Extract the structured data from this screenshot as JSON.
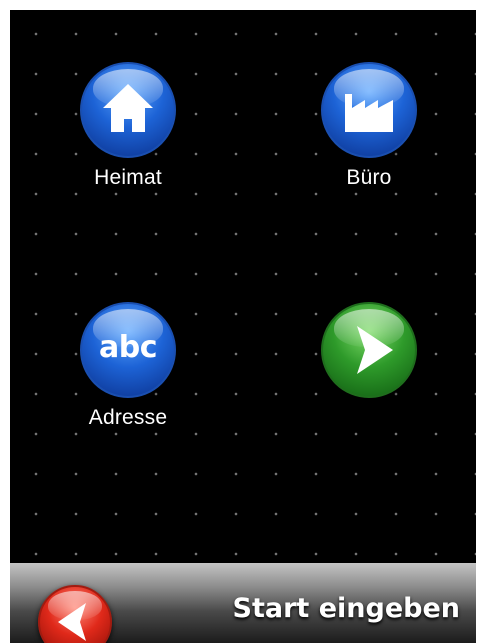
{
  "tiles": [
    {
      "label": "Heimat",
      "icon": "home-icon",
      "color": "#1d63d6"
    },
    {
      "label": "Büro",
      "icon": "factory-icon",
      "color": "#1d63d6"
    },
    {
      "label": "Adresse",
      "icon": "abc-icon",
      "icon_text": "abc",
      "color": "#1d63d6"
    },
    {
      "label": "",
      "icon": "arrow-right-icon",
      "color": "#2e9a2a"
    }
  ],
  "footer": {
    "title": "Start eingeben",
    "back_icon": "arrow-left-icon",
    "back_color": "#e0291a"
  }
}
